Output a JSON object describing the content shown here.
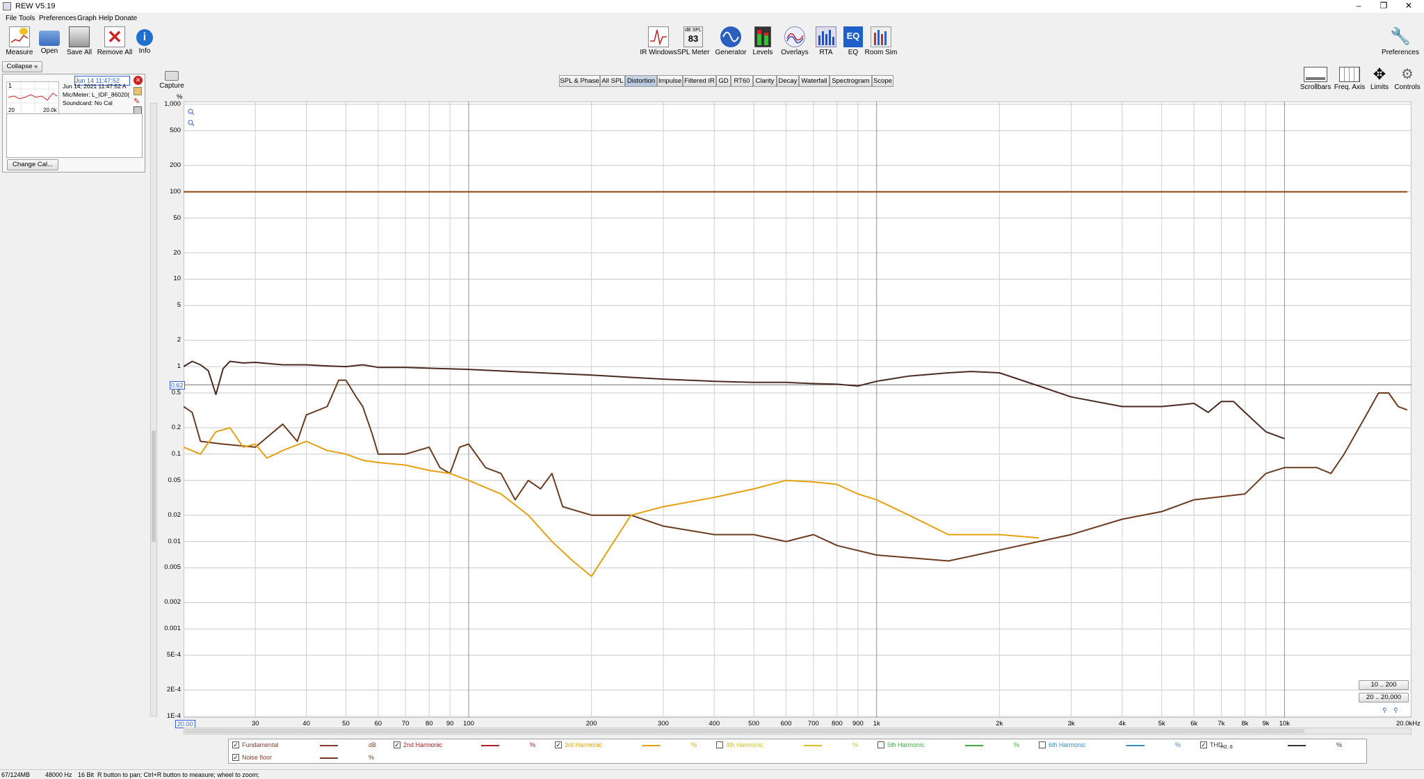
{
  "app": {
    "title": "REW V5.19"
  },
  "menu": [
    "File",
    "Tools",
    "Preferences",
    "Graph",
    "Help",
    "Donate"
  ],
  "toolbar_left": [
    {
      "label": "Measure",
      "icon": "measure-icon"
    },
    {
      "label": "Open",
      "icon": "open-folder-icon"
    },
    {
      "label": "Save All",
      "icon": "save-all-icon"
    },
    {
      "label": "Remove All",
      "icon": "remove-all-icon"
    },
    {
      "label": "Info",
      "icon": "info-icon"
    }
  ],
  "toolbar_center": [
    {
      "label": "IR Windows",
      "icon": "ir-windows-icon"
    },
    {
      "label": "SPL Meter",
      "icon": "spl-meter-icon",
      "badge_top": "dB SPL",
      "badge_val": "83"
    },
    {
      "label": "Generator",
      "icon": "generator-icon"
    },
    {
      "label": "Levels",
      "icon": "levels-icon"
    },
    {
      "label": "Overlays",
      "icon": "overlays-icon"
    },
    {
      "label": "RTA",
      "icon": "rta-icon"
    },
    {
      "label": "EQ",
      "icon": "eq-icon"
    },
    {
      "label": "Room Sim",
      "icon": "room-sim-icon"
    }
  ],
  "toolbar_right": {
    "preferences": "Preferences",
    "scrollbars": "Scrollbars",
    "freq_axis": "Freq. Axis",
    "limits": "Limits",
    "controls": "Controls"
  },
  "measurements": {
    "collapse": "Collapse",
    "name_value": "Jun 14 11:47:52",
    "index": "1",
    "date": "Jun 14, 2021 11:47:52 A",
    "mic": "Mic/Meter: L_IDF_86020(",
    "soundcard": "Soundcard: No Cal",
    "thumb_x_min": "20",
    "thumb_x_max": "20.0k",
    "change_cal": "Change Cal..."
  },
  "capture": "Capture",
  "tabs": [
    "SPL & Phase",
    "All SPL",
    "Distortion",
    "Impulse",
    "Filtered IR",
    "GD",
    "RT60",
    "Clarity",
    "Decay",
    "Waterfall",
    "Spectrogram",
    "Scope"
  ],
  "selected_tab": "Distortion",
  "chart_data": {
    "type": "line",
    "y_unit": "%",
    "y_scale": "log",
    "ylim": [
      0.0001,
      1000
    ],
    "y_ticks": [
      "1,000",
      "500",
      "200",
      "100",
      "50",
      "20",
      "10",
      "5",
      "2",
      "1",
      "0.5",
      "0.2",
      "0.1",
      "0.05",
      "0.02",
      "0.01",
      "0.005",
      "0.002",
      "0.001",
      "5E-4",
      "2E-4",
      "1E-4"
    ],
    "x_scale": "log",
    "xlim": [
      20,
      20000
    ],
    "x_ticks": [
      "30",
      "40",
      "50",
      "60",
      "70",
      "80",
      "90",
      "100",
      "200",
      "300",
      "400",
      "500",
      "600",
      "700",
      "800",
      "900",
      "1k",
      "2k",
      "3k",
      "4k",
      "5k",
      "6k",
      "7k",
      "8k",
      "9k",
      "10k"
    ],
    "x_start_label": "20.00",
    "x_end_label": "20.0kHz",
    "cursor_y_label": "0.62",
    "series": [
      {
        "name": "Fundamental",
        "color": "#8b4513",
        "constant": 100
      },
      {
        "name": "THD",
        "color": "#4a2a22",
        "points": [
          [
            20,
            1.0
          ],
          [
            21,
            1.15
          ],
          [
            22,
            1.05
          ],
          [
            23,
            0.9
          ],
          [
            24,
            0.48
          ],
          [
            25,
            0.95
          ],
          [
            26,
            1.15
          ],
          [
            28,
            1.1
          ],
          [
            30,
            1.12
          ],
          [
            35,
            1.05
          ],
          [
            40,
            1.05
          ],
          [
            45,
            1.02
          ],
          [
            50,
            1.0
          ],
          [
            55,
            1.05
          ],
          [
            60,
            0.98
          ],
          [
            70,
            0.98
          ],
          [
            80,
            0.96
          ],
          [
            100,
            0.93
          ],
          [
            150,
            0.85
          ],
          [
            200,
            0.8
          ],
          [
            300,
            0.72
          ],
          [
            400,
            0.68
          ],
          [
            500,
            0.66
          ],
          [
            600,
            0.66
          ],
          [
            700,
            0.64
          ],
          [
            800,
            0.63
          ],
          [
            900,
            0.6
          ],
          [
            1000,
            0.68
          ],
          [
            1200,
            0.78
          ],
          [
            1500,
            0.85
          ],
          [
            1700,
            0.88
          ],
          [
            2000,
            0.85
          ],
          [
            2500,
            0.6
          ],
          [
            3000,
            0.45
          ],
          [
            4000,
            0.35
          ],
          [
            5000,
            0.35
          ],
          [
            6000,
            0.38
          ],
          [
            6500,
            0.3
          ],
          [
            7000,
            0.4
          ],
          [
            7500,
            0.4
          ],
          [
            8000,
            0.3
          ],
          [
            9000,
            0.18
          ],
          [
            10000,
            0.15
          ]
        ]
      },
      {
        "name": "2nd Harmonic",
        "color": "#6b3a1f",
        "points": [
          [
            20,
            0.35
          ],
          [
            21,
            0.3
          ],
          [
            22,
            0.14
          ],
          [
            25,
            0.13
          ],
          [
            30,
            0.12
          ],
          [
            35,
            0.22
          ],
          [
            38,
            0.14
          ],
          [
            40,
            0.28
          ],
          [
            45,
            0.35
          ],
          [
            48,
            0.7
          ],
          [
            50,
            0.7
          ],
          [
            53,
            0.45
          ],
          [
            55,
            0.35
          ],
          [
            58,
            0.17
          ],
          [
            60,
            0.1
          ],
          [
            70,
            0.1
          ],
          [
            80,
            0.12
          ],
          [
            85,
            0.07
          ],
          [
            90,
            0.06
          ],
          [
            95,
            0.12
          ],
          [
            100,
            0.13
          ],
          [
            110,
            0.07
          ],
          [
            120,
            0.06
          ],
          [
            130,
            0.03
          ],
          [
            140,
            0.05
          ],
          [
            150,
            0.04
          ],
          [
            160,
            0.06
          ],
          [
            170,
            0.025
          ],
          [
            200,
            0.02
          ],
          [
            250,
            0.02
          ],
          [
            300,
            0.015
          ],
          [
            400,
            0.012
          ],
          [
            500,
            0.012
          ],
          [
            600,
            0.01
          ],
          [
            700,
            0.012
          ],
          [
            800,
            0.009
          ],
          [
            1000,
            0.007
          ],
          [
            1500,
            0.006
          ],
          [
            2000,
            0.008
          ],
          [
            3000,
            0.012
          ],
          [
            4000,
            0.018
          ],
          [
            5000,
            0.022
          ],
          [
            6000,
            0.03
          ],
          [
            8000,
            0.035
          ],
          [
            9000,
            0.06
          ],
          [
            10000,
            0.07
          ],
          [
            12000,
            0.07
          ],
          [
            13000,
            0.06
          ],
          [
            14000,
            0.1
          ],
          [
            16000,
            0.3
          ],
          [
            17000,
            0.5
          ],
          [
            18000,
            0.5
          ],
          [
            19000,
            0.35
          ],
          [
            20000,
            0.32
          ]
        ]
      },
      {
        "name": "3rd Harmonic",
        "color": "#e6a010",
        "points": [
          [
            20,
            0.12
          ],
          [
            22,
            0.1
          ],
          [
            24,
            0.18
          ],
          [
            26,
            0.2
          ],
          [
            28,
            0.12
          ],
          [
            30,
            0.13
          ],
          [
            32,
            0.09
          ],
          [
            35,
            0.11
          ],
          [
            40,
            0.14
          ],
          [
            45,
            0.11
          ],
          [
            50,
            0.1
          ],
          [
            55,
            0.085
          ],
          [
            60,
            0.08
          ],
          [
            70,
            0.075
          ],
          [
            80,
            0.065
          ],
          [
            90,
            0.06
          ],
          [
            100,
            0.05
          ],
          [
            120,
            0.035
          ],
          [
            140,
            0.02
          ],
          [
            160,
            0.01
          ],
          [
            180,
            0.006
          ],
          [
            200,
            0.004
          ],
          [
            220,
            0.008
          ],
          [
            250,
            0.02
          ],
          [
            300,
            0.025
          ],
          [
            400,
            0.032
          ],
          [
            500,
            0.04
          ],
          [
            600,
            0.05
          ],
          [
            700,
            0.048
          ],
          [
            800,
            0.045
          ],
          [
            900,
            0.035
          ],
          [
            1000,
            0.03
          ],
          [
            1200,
            0.02
          ],
          [
            1500,
            0.012
          ],
          [
            2000,
            0.012
          ],
          [
            2500,
            0.011
          ]
        ]
      }
    ]
  },
  "limits": {
    "btn1": "10 .. 200",
    "btn2": "20 .. 20,000"
  },
  "legend": [
    {
      "label": "Fundamental",
      "unit": "dB",
      "color": "#8b3a2a",
      "checked": true
    },
    {
      "label": "2nd Harmonic",
      "unit": "%",
      "color": "#b02020",
      "checked": true
    },
    {
      "label": "3rd Harmonic",
      "unit": "%",
      "color": "#e6a010",
      "checked": true
    },
    {
      "label": "4th Harmonic",
      "unit": "%",
      "color": "#d4c020",
      "checked": false
    },
    {
      "label": "5th Harmonic",
      "unit": "%",
      "color": "#40b040",
      "checked": false
    },
    {
      "label": "6th Harmonic",
      "unit": "%",
      "color": "#3a8ad0",
      "checked": false
    },
    {
      "label": "THD",
      "sub": "H2..6",
      "unit": "%",
      "color": "#333333",
      "checked": true
    },
    {
      "label": "Noise floor",
      "unit": "%",
      "color": "#6b3a1f",
      "checked": true
    }
  ],
  "status": {
    "memory": "67/124MB",
    "rate": "48000 Hz",
    "bits": "16 Bit",
    "hint": "R button to pan; Ctrl+R button to measure; wheel to zoom;"
  }
}
